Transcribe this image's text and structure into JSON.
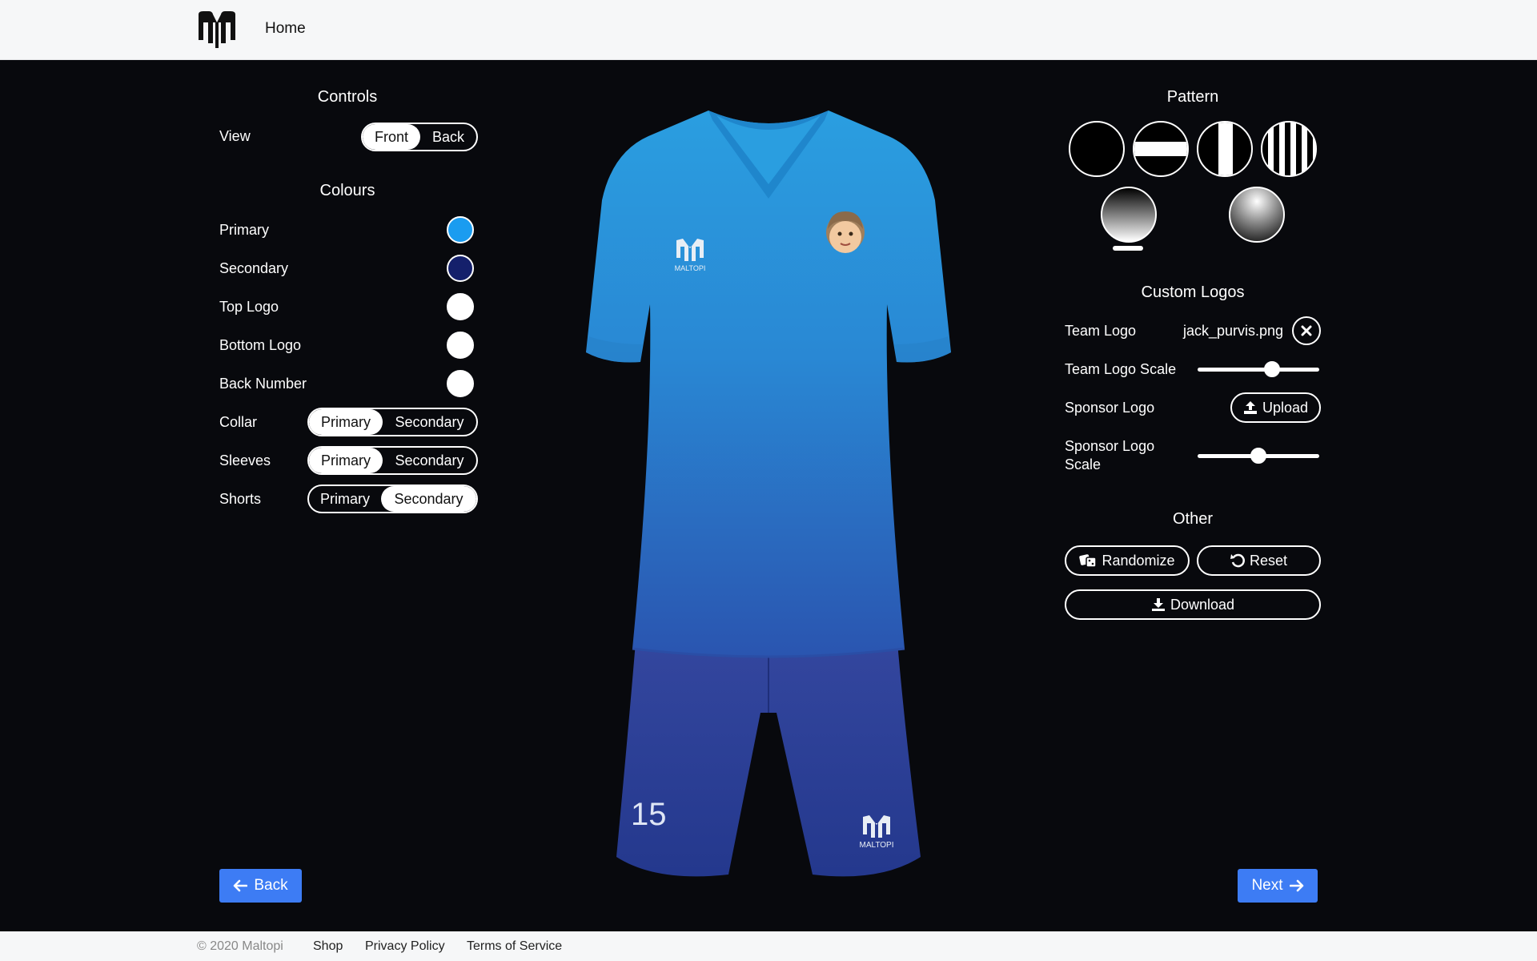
{
  "header": {
    "home_label": "Home"
  },
  "controls": {
    "title": "Controls",
    "view": {
      "label": "View",
      "options": [
        "Front",
        "Back"
      ],
      "selected": "Front"
    }
  },
  "colours": {
    "title": "Colours",
    "items": [
      {
        "label": "Primary",
        "color": "#1a9cf0"
      },
      {
        "label": "Secondary",
        "color": "#14206b"
      },
      {
        "label": "Top Logo",
        "color": "#ffffff"
      },
      {
        "label": "Bottom Logo",
        "color": "#ffffff"
      },
      {
        "label": "Back Number",
        "color": "#ffffff"
      }
    ],
    "toggles": [
      {
        "label": "Collar",
        "options": [
          "Primary",
          "Secondary"
        ],
        "selected": "Primary"
      },
      {
        "label": "Sleeves",
        "options": [
          "Primary",
          "Secondary"
        ],
        "selected": "Primary"
      },
      {
        "label": "Shorts",
        "options": [
          "Primary",
          "Secondary"
        ],
        "selected": "Secondary"
      }
    ]
  },
  "pattern": {
    "title": "Pattern",
    "options": [
      "plain",
      "horizontal-band",
      "center-stripe",
      "pinstripes",
      "gradient-vertical",
      "gradient-radial"
    ],
    "selected": "gradient-vertical"
  },
  "custom_logos": {
    "title": "Custom Logos",
    "team_logo_label": "Team Logo",
    "team_logo_file": "jack_purvis.png",
    "team_logo_scale_label": "Team Logo Scale",
    "team_logo_scale": 0.63,
    "sponsor_logo_label": "Sponsor Logo",
    "upload_label": "Upload",
    "sponsor_logo_scale_label_1": "Sponsor Logo",
    "sponsor_logo_scale_label_2": "Scale",
    "sponsor_logo_scale": 0.5
  },
  "other": {
    "title": "Other",
    "randomize_label": "Randomize",
    "reset_label": "Reset",
    "download_label": "Download"
  },
  "kit": {
    "brand_text": "MALTOPI",
    "back_number": "15",
    "shirt_top_color": "#2a9ee0",
    "shirt_bottom_color": "#2a55b0",
    "shorts_color": "#2b3f9a"
  },
  "nav": {
    "back_label": "Back",
    "next_label": "Next"
  },
  "footer": {
    "copyright": "© 2020 Maltopi",
    "links": [
      "Shop",
      "Privacy Policy",
      "Terms of Service"
    ]
  }
}
